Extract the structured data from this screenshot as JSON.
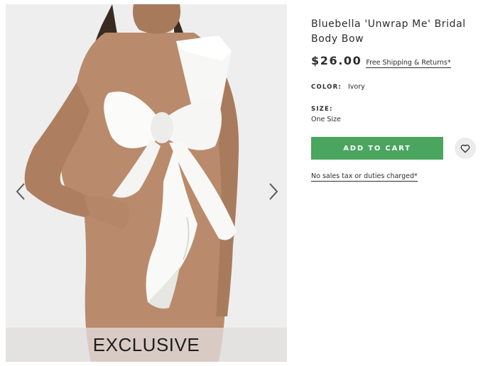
{
  "product": {
    "title": "Bluebella 'Unwrap Me' Bridal Body Bow",
    "price": "$26.00",
    "shipping_link": "Free Shipping & Returns*",
    "color_label": "COLOR:",
    "color_value": "Ivory",
    "size_label": "SIZE:",
    "size_value": "One Size",
    "add_to_cart_label": "ADD TO CART",
    "tax_note": "No sales tax or duties charged*"
  },
  "gallery": {
    "badge": "EXCLUSIVE",
    "prev_icon": "chevron-left-icon",
    "next_icon": "chevron-right-icon"
  },
  "icons": {
    "wishlist": "heart-icon"
  },
  "colors": {
    "accent_green": "#4aa55e",
    "text": "#2d2d2d",
    "image_background": "#eeeeef",
    "wishlist_background": "#ececec"
  }
}
